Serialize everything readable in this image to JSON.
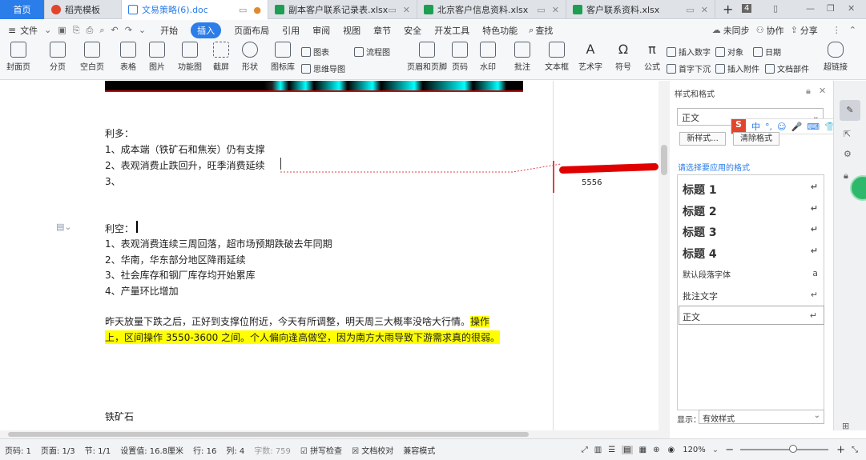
{
  "tabs": [
    {
      "label": "首页",
      "color": "#2b7de9"
    },
    {
      "label": "稻壳模板",
      "color": "#e2452c"
    },
    {
      "label": "文易策略(6).doc",
      "color": "#2b7de9"
    },
    {
      "label": "副本客户联系记录表.xlsx",
      "color": "#1e9e53"
    },
    {
      "label": "北京客户信息资料.xlsx",
      "color": "#1e9e53"
    },
    {
      "label": "客户联系资料.xlsx",
      "color": "#1e9e53"
    }
  ],
  "tab_controls": {
    "add": "+",
    "count": "4",
    "minimize": "—",
    "restore": "❐",
    "close": "✕"
  },
  "menubar": {
    "file": "文件",
    "items": [
      "开始",
      "插入",
      "页面布局",
      "引用",
      "审阅",
      "视图",
      "章节",
      "安全",
      "开发工具",
      "特色功能"
    ],
    "active": "插入",
    "search": "查找",
    "sync": "未同步",
    "collab": "协作",
    "share": "分享"
  },
  "toolbar": {
    "large": [
      "封面页",
      "分页",
      "空白页",
      "表格",
      "图片",
      "功能图",
      "截屏",
      "形状",
      "图标库",
      "页眉和页脚",
      "页码",
      "水印",
      "批注",
      "文本框",
      "艺术字",
      "符号",
      "公式"
    ],
    "small": [
      "图表",
      "思维导图",
      "流程图",
      "插入数字",
      "对象",
      "日期",
      "首字下沉",
      "插入附件",
      "文档部件",
      "超链接"
    ]
  },
  "document": {
    "lines": [
      "利多：",
      "1、成本端（铁矿石和焦炭）仍有支撑",
      "2、表观消费止跌回升，旺季消费延续",
      "3、",
      "利空：",
      "1、表观消费连续三周回落，超市场预期跌破去年同期",
      "2、华南，华东部分地区降雨延续",
      "3、社会库存和钢厂库存均开始累库",
      "4、产量环比增加"
    ],
    "para_normal": "昨天放量下跌之后，正好到支撑位附近，今天有所调整，明天周三大概率没啥大行情。",
    "para_highlight1": "操作",
    "para_highlight2": "上，区间操作 3550-3600 之间。个人偏向逢高做空，因为南方大雨导致下游需求真的很弱。",
    "last": "铁矿石",
    "comment_text": "5556"
  },
  "style_panel": {
    "title": "样式和格式",
    "current": "正文",
    "new_btn": "新样式...",
    "clear_btn": "清除格式",
    "select_label": "请选择要应用的格式",
    "styles": [
      "标题  1",
      "标题  2",
      "标题  3",
      "标题  4",
      "默认段落字体",
      "批注文字",
      "正文"
    ],
    "show_label": "显示：",
    "show_value": "有效样式"
  },
  "ime": [
    "中",
    "°,",
    "☺",
    "🎤",
    "⌨",
    "👕",
    "▦"
  ],
  "statusbar": {
    "page_num": "页码: 1",
    "page": "页面: 1/3",
    "section": "节: 1/1",
    "setting": "设置值: 16.8厘米",
    "row": "行: 16",
    "col": "列: 4",
    "words": "字数: 759",
    "spell": "拼写检查",
    "proof": "文档校对",
    "compat": "兼容模式",
    "zoom": "120%",
    "zoom_level": 0.55
  }
}
